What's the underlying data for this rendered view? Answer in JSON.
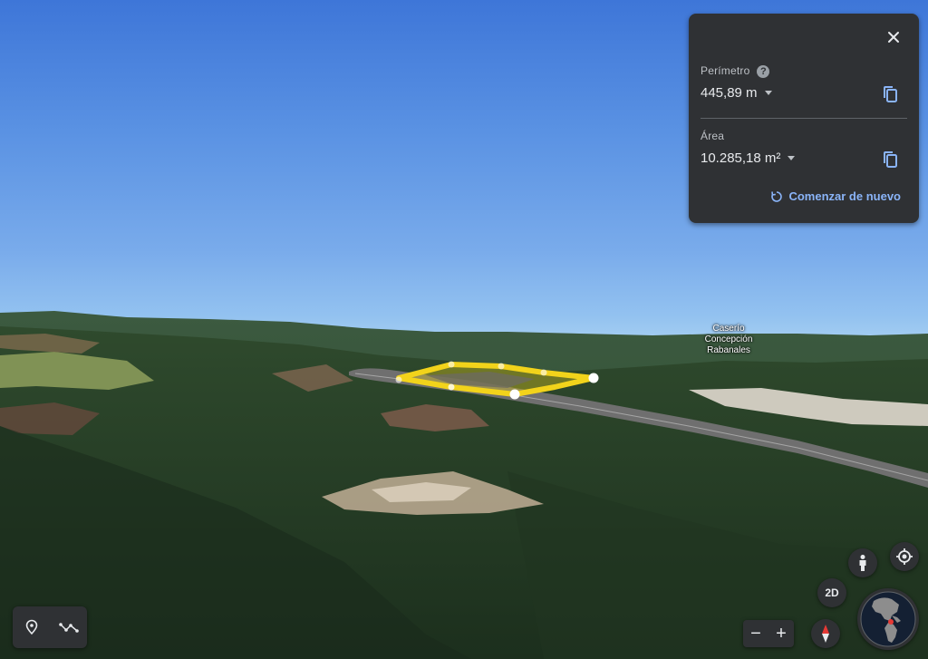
{
  "measure_panel": {
    "perimeter": {
      "label": "Perímetro",
      "help": "?",
      "value": "445,89 m"
    },
    "area": {
      "label": "Área",
      "value": "10.285,18 m²"
    },
    "restart_label": "Comenzar de nuevo"
  },
  "map": {
    "place_label_lines": [
      "Caserío",
      "Concepción",
      "Rabanales"
    ]
  },
  "controls": {
    "view_toggle_label": "2D",
    "zoom_out": "−",
    "zoom_in": "+"
  },
  "icons": {
    "close": "close-icon",
    "copy": "copy-icon",
    "help": "help-icon",
    "restart": "restart-icon",
    "pin": "pin-icon",
    "path": "path-icon",
    "pegman": "pegman-icon",
    "location": "my-location-icon",
    "compass": "compass-icon",
    "globe": "globe-icon"
  },
  "colors": {
    "panel_bg": "#2f3134",
    "accent_link": "#8ab4f8",
    "measurement_polygon": "#f2d31b"
  }
}
